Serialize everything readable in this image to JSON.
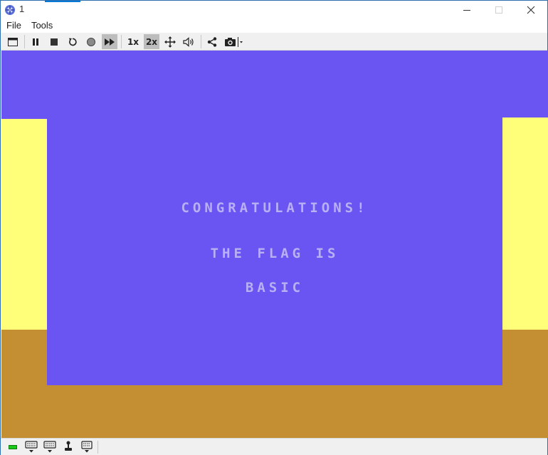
{
  "window": {
    "title": "1",
    "controls": {
      "minimize": "minimize",
      "maximize": "maximize",
      "close": "close"
    }
  },
  "menu": {
    "items": [
      "File",
      "Tools"
    ]
  },
  "toolbar": {
    "speed_1x": "1x",
    "speed_2x": "2x",
    "active_speed": "2x",
    "fast_forward_active": true
  },
  "screen": {
    "line1": "CONGRATULATIONS!",
    "line2": "THE FLAG IS",
    "line3": "BASIC"
  },
  "colors": {
    "background": "#6a55f2",
    "walls": "#ffff7a",
    "floor": "#c48f33",
    "text": "#b8b0f2",
    "disk_led": "#19c819"
  },
  "statusbar": {
    "items": [
      "disk-led-icon",
      "keyboard-icon",
      "keyboard-alt-icon",
      "joystick-icon",
      "keypad-icon"
    ]
  }
}
